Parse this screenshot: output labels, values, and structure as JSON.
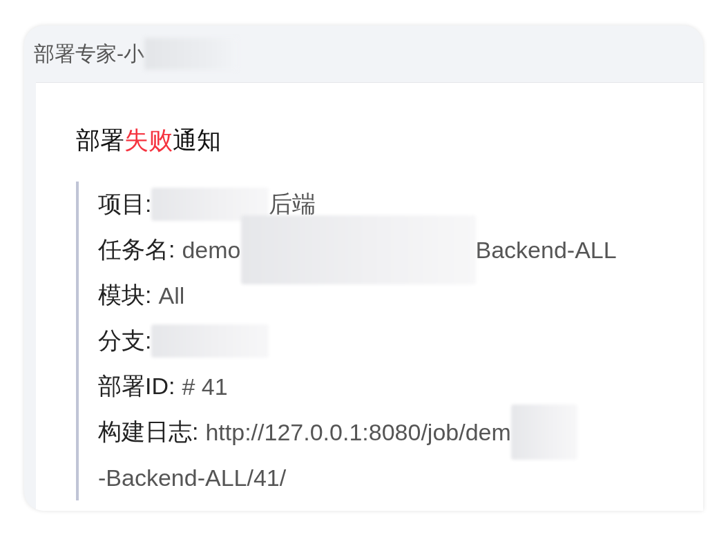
{
  "window": {
    "title": "部署专家-小",
    "title_redacted": true
  },
  "message": {
    "heading": [
      {
        "kind": "plain",
        "text": "部署"
      },
      {
        "kind": "alert",
        "text": "失败"
      },
      {
        "kind": "plain",
        "text": "通知"
      }
    ],
    "lines": [
      {
        "label": "项目:",
        "parts": [
          {
            "kind": "redacted"
          },
          {
            "kind": "text",
            "text": "后端"
          }
        ]
      },
      {
        "label": "任务名:",
        "parts": [
          {
            "kind": "text",
            "text": "demo"
          },
          {
            "kind": "redacted_long"
          },
          {
            "kind": "text",
            "text": "Backend-ALL"
          }
        ]
      },
      {
        "label": "模块:",
        "parts": [
          {
            "kind": "text",
            "text": "All"
          }
        ]
      },
      {
        "label": "分支:",
        "parts": [
          {
            "kind": "redacted"
          }
        ]
      },
      {
        "label": "部署ID:",
        "parts": [
          {
            "kind": "text",
            "text": "# 41"
          }
        ]
      },
      {
        "label": "构建日志:",
        "parts": [
          {
            "kind": "link",
            "text": "http://127.0.0.1:8080/job/dem"
          },
          {
            "kind": "redacted_short"
          },
          {
            "kind": "break"
          },
          {
            "kind": "link",
            "text": "-Backend-ALL/41/"
          }
        ]
      }
    ]
  }
}
